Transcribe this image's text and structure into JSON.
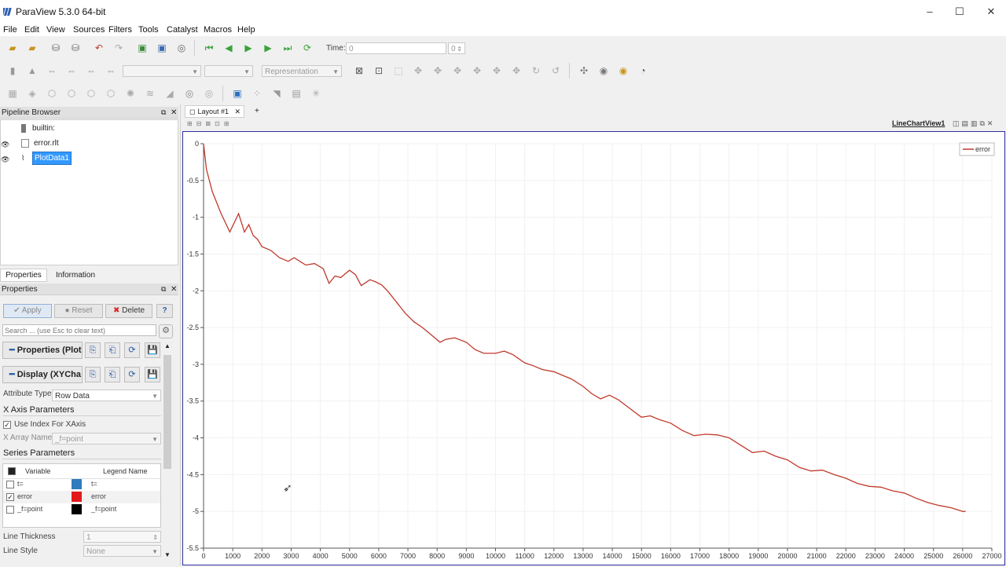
{
  "window": {
    "title": "ParaView 5.3.0 64-bit",
    "min": "–",
    "max": "☐",
    "close": "✕"
  },
  "menu": [
    "File",
    "Edit",
    "View",
    "Sources",
    "Filters",
    "Tools",
    "Catalyst",
    "Macros",
    "Help"
  ],
  "toolbar": {
    "time_label": "Time:",
    "time_value": "0",
    "time_step": "0",
    "representation_placeholder": "Representation"
  },
  "pipeline": {
    "title": "Pipeline Browser",
    "items": [
      {
        "label": "builtin:"
      },
      {
        "label": "error.rlt"
      },
      {
        "label": "PlotData1"
      }
    ]
  },
  "tabs": {
    "properties": "Properties",
    "information": "Information"
  },
  "properties": {
    "title": "Properties",
    "apply": "Apply",
    "reset": "Reset",
    "delete": "Delete",
    "help": "?",
    "search_placeholder": "Search ... (use Esc to clear text)",
    "section_properties": "Properties (Plot",
    "section_display": "Display (XYCha",
    "attribute_type_label": "Attribute Type",
    "attribute_type_value": "Row Data",
    "x_axis_group": "X Axis Parameters",
    "use_index_label": "Use Index For XAxis",
    "x_array_label": "X Array Name",
    "x_array_value": "_f=point",
    "series_group": "Series Parameters",
    "series_col_variable": "Variable",
    "series_col_legend": "Legend Name",
    "series": [
      {
        "variable": "t=",
        "legend": "t=",
        "checked": false,
        "color": "#2f7bbd"
      },
      {
        "variable": "error",
        "legend": "error",
        "checked": true,
        "color": "#e31a1c"
      },
      {
        "variable": "_f=point",
        "legend": "_f=point",
        "checked": false,
        "color": "#000000"
      }
    ],
    "line_thickness_label": "Line Thickness",
    "line_thickness_value": "1",
    "line_style_label": "Line Style",
    "line_style_value": "None"
  },
  "layout": {
    "tab": "Layout #1",
    "add": "+",
    "view_name": "LineChartView1"
  },
  "chart_data": {
    "type": "line",
    "xlim": [
      0,
      27000
    ],
    "ylim": [
      -5.5,
      0
    ],
    "xticks": [
      0,
      1000,
      2000,
      3000,
      4000,
      5000,
      6000,
      7000,
      8000,
      9000,
      10000,
      11000,
      12000,
      13000,
      14000,
      15000,
      16000,
      17000,
      18000,
      19000,
      20000,
      21000,
      22000,
      23000,
      24000,
      25000,
      26000,
      27000
    ],
    "yticks": [
      0,
      -0.5,
      -1,
      -1.5,
      -2,
      -2.5,
      -3,
      -3.5,
      -4,
      -4.5,
      -5,
      -5.5
    ],
    "legend_position": "top-right",
    "grid": true,
    "series": [
      {
        "name": "error",
        "color": "#c0392b",
        "x": [
          0,
          100,
          300,
          600,
          900,
          1200,
          1400,
          1550,
          1700,
          1850,
          2000,
          2300,
          2600,
          2900,
          3100,
          3300,
          3500,
          3800,
          4100,
          4300,
          4500,
          4700,
          5000,
          5200,
          5400,
          5700,
          5900,
          6100,
          6300,
          6600,
          6900,
          7200,
          7500,
          7800,
          8100,
          8300,
          8600,
          9000,
          9300,
          9600,
          10000,
          10300,
          10600,
          11000,
          11300,
          11600,
          12000,
          12300,
          12600,
          13000,
          13300,
          13600,
          13900,
          14200,
          14600,
          15000,
          15300,
          15600,
          16000,
          16400,
          16800,
          17200,
          17600,
          18000,
          18400,
          18800,
          19200,
          19600,
          20000,
          20400,
          20800,
          21200,
          21600,
          22000,
          22400,
          22800,
          23200,
          23600,
          24000,
          24400,
          24800,
          25200,
          25600,
          26000,
          26100
        ],
        "y": [
          0,
          -0.35,
          -0.65,
          -0.95,
          -1.2,
          -0.95,
          -1.2,
          -1.1,
          -1.25,
          -1.3,
          -1.4,
          -1.45,
          -1.55,
          -1.6,
          -1.55,
          -1.6,
          -1.65,
          -1.63,
          -1.7,
          -1.9,
          -1.8,
          -1.82,
          -1.72,
          -1.78,
          -1.93,
          -1.85,
          -1.88,
          -1.92,
          -2.0,
          -2.15,
          -2.3,
          -2.42,
          -2.5,
          -2.6,
          -2.7,
          -2.66,
          -2.64,
          -2.7,
          -2.8,
          -2.85,
          -2.85,
          -2.82,
          -2.87,
          -2.98,
          -3.02,
          -3.07,
          -3.1,
          -3.15,
          -3.2,
          -3.3,
          -3.4,
          -3.47,
          -3.42,
          -3.48,
          -3.6,
          -3.72,
          -3.7,
          -3.75,
          -3.8,
          -3.9,
          -3.97,
          -3.95,
          -3.96,
          -4.0,
          -4.1,
          -4.2,
          -4.18,
          -4.25,
          -4.3,
          -4.4,
          -4.45,
          -4.44,
          -4.5,
          -4.55,
          -4.62,
          -4.66,
          -4.67,
          -4.72,
          -4.75,
          -4.82,
          -4.88,
          -4.92,
          -4.95,
          -5.0,
          -5.0
        ]
      }
    ]
  }
}
